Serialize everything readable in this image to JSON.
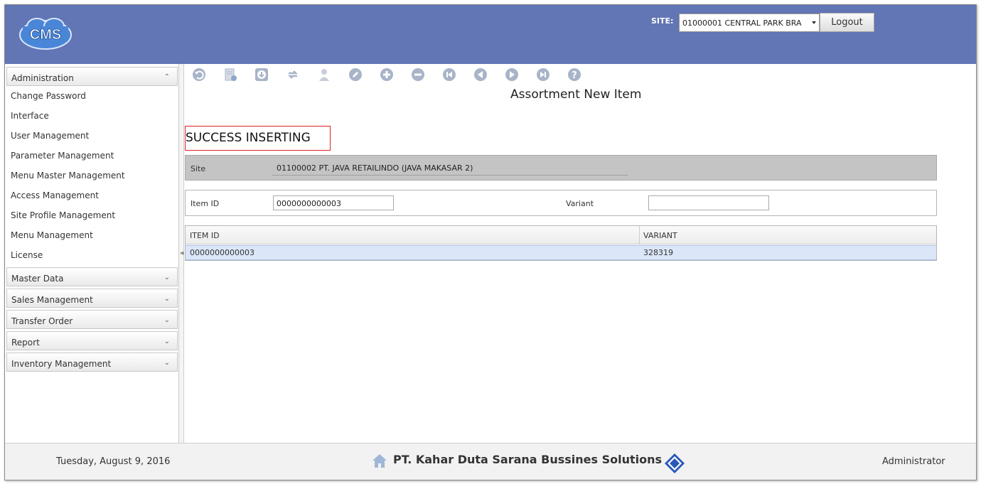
{
  "header": {
    "logo_text": "CMS",
    "site_label": "SITE:",
    "site_value": "01000001 CENTRAL PARK BRA",
    "logout_label": "Logout"
  },
  "sidebar": {
    "groups": [
      {
        "label": "Administration",
        "expanded": true
      },
      {
        "label": "Master Data",
        "expanded": false
      },
      {
        "label": "Sales Management",
        "expanded": false
      },
      {
        "label": "Transfer Order",
        "expanded": false
      },
      {
        "label": "Report",
        "expanded": false
      },
      {
        "label": "Inventory Management",
        "expanded": false
      }
    ],
    "items": [
      "Change Password",
      "Interface",
      "User Management",
      "Parameter Management",
      "Menu Master Management",
      "Access Management",
      "Site Profile Management",
      "Menu Management",
      "License"
    ]
  },
  "toolbar": {
    "icons": [
      "undo-icon",
      "approve-doc-icon",
      "download-icon",
      "refresh-icon",
      "user-icon",
      "edit-icon",
      "add-icon",
      "remove-icon",
      "first-icon",
      "previous-icon",
      "next-icon",
      "last-icon",
      "help-icon"
    ]
  },
  "main": {
    "title": "Assortment New Item",
    "message": "SUCCESS INSERTING",
    "site_label": "Site",
    "site_value": "01100002 PT. JAVA RETAILINDO (JAVA MAKASAR 2)",
    "item_id_label": "Item ID",
    "item_id_value": "0000000000003",
    "variant_label": "Variant",
    "variant_value": ""
  },
  "grid": {
    "columns": [
      "ITEM ID",
      "VARIANT"
    ],
    "rows": [
      [
        "0000000000003",
        "328319"
      ]
    ]
  },
  "footer": {
    "date": "Tuesday, August 9, 2016",
    "company": "PT. Kahar Duta Sarana Bussines Solutions",
    "user": "Administrator"
  },
  "colors": {
    "header_bg": "#6275b5",
    "toolbar_icon": "#a8b4c8",
    "success_border": "#dd2222",
    "selected_row": "#dbe6f8"
  }
}
